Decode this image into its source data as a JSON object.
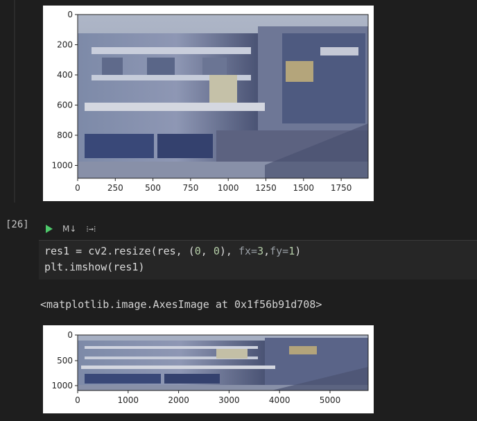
{
  "cell": {
    "execution_count": "[26]",
    "toolbar": {
      "markdown_label": "M↓",
      "split_label": "⁞→⁞"
    },
    "code": {
      "line1_prefix": "res1 = cv2.resize(res, (",
      "zero1": "0",
      "sep": ", ",
      "zero2": "0",
      "mid": "), ",
      "fx_kw": "fx=",
      "fx_val": "3",
      "comma": ",",
      "fy_kw": "fy=",
      "fy_val": "1",
      "close": ")",
      "line2": "plt.imshow(res1)"
    },
    "output_text": "<matplotlib.image.AxesImage at 0x1f56b91d708>"
  },
  "figure1": {
    "y_ticks": [
      "0",
      "200",
      "400",
      "600",
      "800",
      "1000"
    ],
    "x_ticks": [
      "0",
      "250",
      "500",
      "750",
      "1000",
      "1250",
      "1500",
      "1750"
    ]
  },
  "figure2": {
    "y_ticks": [
      "0",
      "500",
      "1000"
    ],
    "x_ticks": [
      "0",
      "1000",
      "2000",
      "3000",
      "4000",
      "5000"
    ]
  }
}
